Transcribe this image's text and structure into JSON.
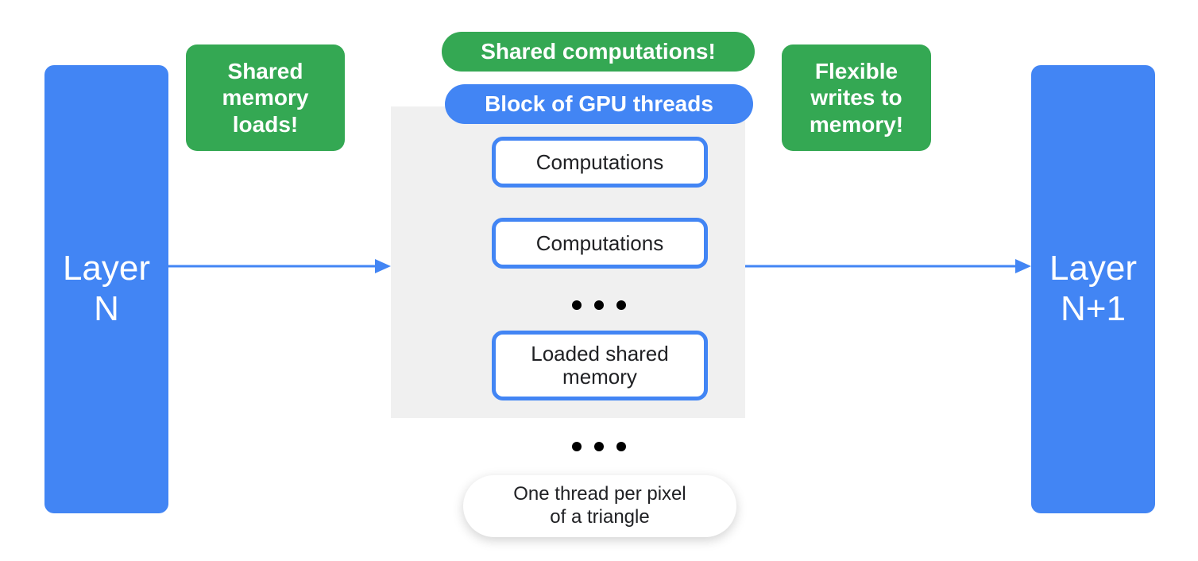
{
  "colors": {
    "blue": "#4285f4",
    "green": "#34a853",
    "grey": "#f0f0f0",
    "text": "#202124"
  },
  "left_layer": {
    "line1": "Layer",
    "line2": "N"
  },
  "right_layer": {
    "line1": "Layer",
    "line2": "N+1"
  },
  "callouts": {
    "shared_loads": "Shared\nmemory\nloads!",
    "shared_comps": "Shared computations!",
    "flexible_writes": "Flexible\nwrites to\nmemory!"
  },
  "block_header": "Block of GPU threads",
  "comp_boxes": {
    "comp1": "Computations",
    "comp2": "Computations",
    "loaded_shared": "Loaded shared\nmemory"
  },
  "caption": "One thread per pixel\nof a triangle"
}
